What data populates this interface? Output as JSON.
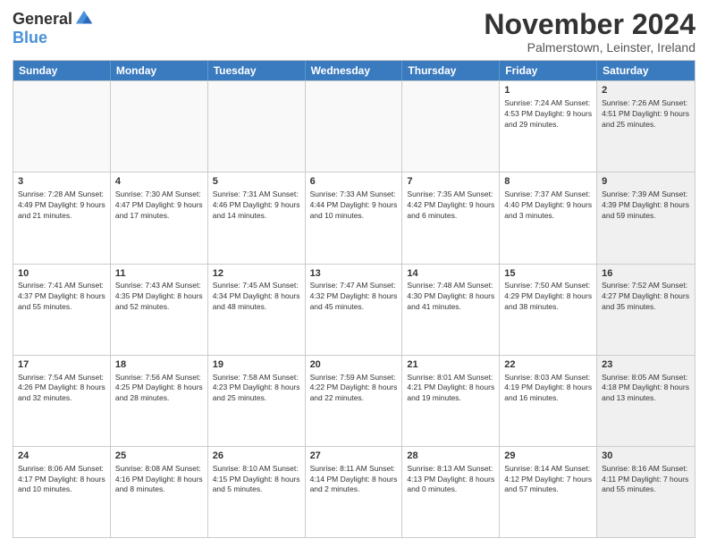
{
  "logo": {
    "general": "General",
    "blue": "Blue"
  },
  "title": "November 2024",
  "location": "Palmerstown, Leinster, Ireland",
  "days": [
    "Sunday",
    "Monday",
    "Tuesday",
    "Wednesday",
    "Thursday",
    "Friday",
    "Saturday"
  ],
  "weeks": [
    [
      {
        "day": "",
        "info": "",
        "empty": true
      },
      {
        "day": "",
        "info": "",
        "empty": true
      },
      {
        "day": "",
        "info": "",
        "empty": true
      },
      {
        "day": "",
        "info": "",
        "empty": true
      },
      {
        "day": "",
        "info": "",
        "empty": true
      },
      {
        "day": "1",
        "info": "Sunrise: 7:24 AM\nSunset: 4:53 PM\nDaylight: 9 hours and 29 minutes."
      },
      {
        "day": "2",
        "info": "Sunrise: 7:26 AM\nSunset: 4:51 PM\nDaylight: 9 hours and 25 minutes."
      }
    ],
    [
      {
        "day": "3",
        "info": "Sunrise: 7:28 AM\nSunset: 4:49 PM\nDaylight: 9 hours and 21 minutes."
      },
      {
        "day": "4",
        "info": "Sunrise: 7:30 AM\nSunset: 4:47 PM\nDaylight: 9 hours and 17 minutes."
      },
      {
        "day": "5",
        "info": "Sunrise: 7:31 AM\nSunset: 4:46 PM\nDaylight: 9 hours and 14 minutes."
      },
      {
        "day": "6",
        "info": "Sunrise: 7:33 AM\nSunset: 4:44 PM\nDaylight: 9 hours and 10 minutes."
      },
      {
        "day": "7",
        "info": "Sunrise: 7:35 AM\nSunset: 4:42 PM\nDaylight: 9 hours and 6 minutes."
      },
      {
        "day": "8",
        "info": "Sunrise: 7:37 AM\nSunset: 4:40 PM\nDaylight: 9 hours and 3 minutes."
      },
      {
        "day": "9",
        "info": "Sunrise: 7:39 AM\nSunset: 4:39 PM\nDaylight: 8 hours and 59 minutes."
      }
    ],
    [
      {
        "day": "10",
        "info": "Sunrise: 7:41 AM\nSunset: 4:37 PM\nDaylight: 8 hours and 55 minutes."
      },
      {
        "day": "11",
        "info": "Sunrise: 7:43 AM\nSunset: 4:35 PM\nDaylight: 8 hours and 52 minutes."
      },
      {
        "day": "12",
        "info": "Sunrise: 7:45 AM\nSunset: 4:34 PM\nDaylight: 8 hours and 48 minutes."
      },
      {
        "day": "13",
        "info": "Sunrise: 7:47 AM\nSunset: 4:32 PM\nDaylight: 8 hours and 45 minutes."
      },
      {
        "day": "14",
        "info": "Sunrise: 7:48 AM\nSunset: 4:30 PM\nDaylight: 8 hours and 41 minutes."
      },
      {
        "day": "15",
        "info": "Sunrise: 7:50 AM\nSunset: 4:29 PM\nDaylight: 8 hours and 38 minutes."
      },
      {
        "day": "16",
        "info": "Sunrise: 7:52 AM\nSunset: 4:27 PM\nDaylight: 8 hours and 35 minutes."
      }
    ],
    [
      {
        "day": "17",
        "info": "Sunrise: 7:54 AM\nSunset: 4:26 PM\nDaylight: 8 hours and 32 minutes."
      },
      {
        "day": "18",
        "info": "Sunrise: 7:56 AM\nSunset: 4:25 PM\nDaylight: 8 hours and 28 minutes."
      },
      {
        "day": "19",
        "info": "Sunrise: 7:58 AM\nSunset: 4:23 PM\nDaylight: 8 hours and 25 minutes."
      },
      {
        "day": "20",
        "info": "Sunrise: 7:59 AM\nSunset: 4:22 PM\nDaylight: 8 hours and 22 minutes."
      },
      {
        "day": "21",
        "info": "Sunrise: 8:01 AM\nSunset: 4:21 PM\nDaylight: 8 hours and 19 minutes."
      },
      {
        "day": "22",
        "info": "Sunrise: 8:03 AM\nSunset: 4:19 PM\nDaylight: 8 hours and 16 minutes."
      },
      {
        "day": "23",
        "info": "Sunrise: 8:05 AM\nSunset: 4:18 PM\nDaylight: 8 hours and 13 minutes."
      }
    ],
    [
      {
        "day": "24",
        "info": "Sunrise: 8:06 AM\nSunset: 4:17 PM\nDaylight: 8 hours and 10 minutes."
      },
      {
        "day": "25",
        "info": "Sunrise: 8:08 AM\nSunset: 4:16 PM\nDaylight: 8 hours and 8 minutes."
      },
      {
        "day": "26",
        "info": "Sunrise: 8:10 AM\nSunset: 4:15 PM\nDaylight: 8 hours and 5 minutes."
      },
      {
        "day": "27",
        "info": "Sunrise: 8:11 AM\nSunset: 4:14 PM\nDaylight: 8 hours and 2 minutes."
      },
      {
        "day": "28",
        "info": "Sunrise: 8:13 AM\nSunset: 4:13 PM\nDaylight: 8 hours and 0 minutes."
      },
      {
        "day": "29",
        "info": "Sunrise: 8:14 AM\nSunset: 4:12 PM\nDaylight: 7 hours and 57 minutes."
      },
      {
        "day": "30",
        "info": "Sunrise: 8:16 AM\nSunset: 4:11 PM\nDaylight: 7 hours and 55 minutes."
      }
    ]
  ]
}
